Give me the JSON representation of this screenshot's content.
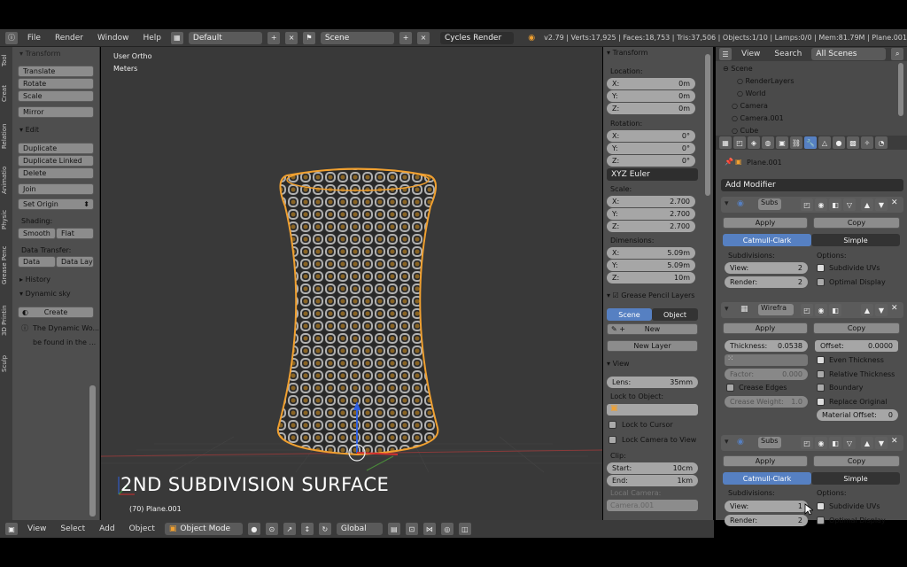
{
  "topbar": {
    "menus": [
      "File",
      "Render",
      "Window",
      "Help"
    ],
    "layout": "Default",
    "scene": "Scene",
    "engine": "Cycles Render",
    "info": "v2.79 | Verts:17,925 | Faces:18,753 | Tris:37,506 | Objects:1/10 | Lamps:0/0 | Mem:81.79M | Plane.001"
  },
  "left": {
    "tabs": [
      "Tool",
      "Creat",
      "Relation",
      "Animatio",
      "Physic",
      "Grease Penc",
      "3D Printin",
      "Sculp"
    ],
    "transform_header": "Transform",
    "translate": "Translate",
    "rotate": "Rotate",
    "scale": "Scale",
    "mirror": "Mirror",
    "edit_header": "Edit",
    "duplicate": "Duplicate",
    "duplicate_linked": "Duplicate Linked",
    "delete": "Delete",
    "join": "Join",
    "set_origin": "Set Origin",
    "shading": "Shading:",
    "smooth": "Smooth",
    "flat": "Flat",
    "data_transfer": "Data Transfer:",
    "data": "Data",
    "data_lay": "Data Lay",
    "history": "History",
    "dynamic_sky": "Dynamic sky",
    "create": "Create",
    "note1": "The Dynamic Wo...",
    "note2": "be found in the ..."
  },
  "viewport": {
    "view_label": "User Ortho",
    "units": "Meters",
    "overlay_title": "2ND SUBDIVISION SURFACE",
    "object_label": "(70) Plane.001"
  },
  "bottombar": {
    "items": [
      "View",
      "Select",
      "Add",
      "Object"
    ],
    "mode": "Object Mode",
    "orientation": "Global"
  },
  "nprops": {
    "transform": "Transform",
    "location": "Location:",
    "loc": [
      {
        "k": "X:",
        "v": "0m"
      },
      {
        "k": "Y:",
        "v": "0m"
      },
      {
        "k": "Z:",
        "v": "0m"
      }
    ],
    "rotation": "Rotation:",
    "rot": [
      {
        "k": "X:",
        "v": "0°"
      },
      {
        "k": "Y:",
        "v": "0°"
      },
      {
        "k": "Z:",
        "v": "0°"
      }
    ],
    "euler": "XYZ Euler",
    "scale": "Scale:",
    "scl": [
      {
        "k": "X:",
        "v": "2.700"
      },
      {
        "k": "Y:",
        "v": "2.700"
      },
      {
        "k": "Z:",
        "v": "2.700"
      }
    ],
    "dimensions": "Dimensions:",
    "dim": [
      {
        "k": "X:",
        "v": "5.09m"
      },
      {
        "k": "Y:",
        "v": "5.09m"
      },
      {
        "k": "Z:",
        "v": "10m"
      }
    ],
    "grease": "Grease Pencil Layers",
    "scene": "Scene",
    "object": "Object",
    "new": "New",
    "new_layer": "New Layer",
    "view": "View",
    "lens_k": "Lens:",
    "lens_v": "35mm",
    "lock_to_object": "Lock to Object:",
    "lock_cursor": "Lock to Cursor",
    "lock_camera": "Lock Camera to View",
    "clip": "Clip:",
    "start_k": "Start:",
    "start_v": "10cm",
    "end_k": "End:",
    "end_v": "1km",
    "local_camera": "Local Camera:",
    "camera": "Camera.001"
  },
  "outliner": {
    "view": "View",
    "search": "Search",
    "scenes": "All Scenes",
    "items": [
      "Scene",
      "RenderLayers",
      "World",
      "Camera",
      "Camera.001",
      "Cube"
    ]
  },
  "modifiers": {
    "object": "Plane.001",
    "add_modifier": "Add Modifier",
    "apply": "Apply",
    "copy": "Copy",
    "mod1_name": "Subs",
    "catmull": "Catmull-Clark",
    "simple": "Simple",
    "subdivisions": "Subdivisions:",
    "options": "Options:",
    "view_k": "View:",
    "view_v": "2",
    "render_k": "Render:",
    "render_v": "2",
    "subdivide_uvs": "Subdivide UVs",
    "optimal_display": "Optimal Display",
    "mod2_name": "Wirefra",
    "thickness_k": "Thickness:",
    "thickness_v": "0.0538",
    "offset_k": "Offset:",
    "offset_v": "0.0000",
    "even_thickness": "Even Thickness",
    "relative_thickness": "Relative Thickness",
    "factor_k": "Factor:",
    "factor_v": "0.000",
    "boundary": "Boundary",
    "crease_edges": "Crease Edges",
    "replace_original": "Replace Original",
    "crease_weight_k": "Crease Weight:",
    "crease_weight_v": "1.0",
    "material_offset_k": "Material Offset:",
    "material_offset_v": "0",
    "mod3_name": "Subs",
    "view3_v": "1"
  },
  "colors": {
    "accent": "#5680c2",
    "select": "#f0a030"
  }
}
